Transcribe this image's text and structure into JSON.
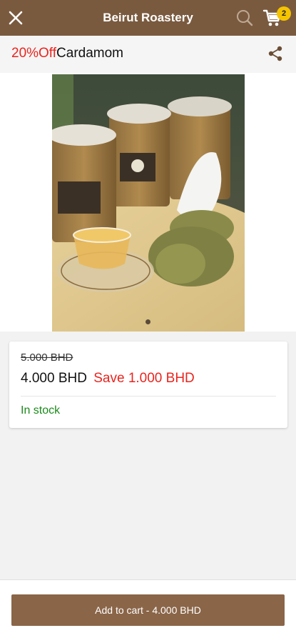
{
  "header": {
    "title": "Beirut Roastery",
    "cart_count": "2",
    "icons": {
      "close": "close-icon",
      "search": "search-icon",
      "cart": "cart-icon"
    }
  },
  "product": {
    "discount_label": "20%Off",
    "name": "Cardamom",
    "share_icon": "share-icon",
    "gallery": {
      "image_count": 1,
      "active_index": 0
    }
  },
  "pricing": {
    "old_price": "5.000 BHD",
    "new_price": "4.000 BHD",
    "save_text": "Save 1.000 BHD",
    "stock_status": "In stock"
  },
  "actions": {
    "add_to_cart_label": "Add to cart - 4.000 BHD"
  },
  "colors": {
    "header_bg": "#7a5a3f",
    "button_bg": "#8a6548",
    "discount_red": "#e8251f",
    "stock_green": "#1b8a1b",
    "badge_yellow": "#f5c400"
  }
}
